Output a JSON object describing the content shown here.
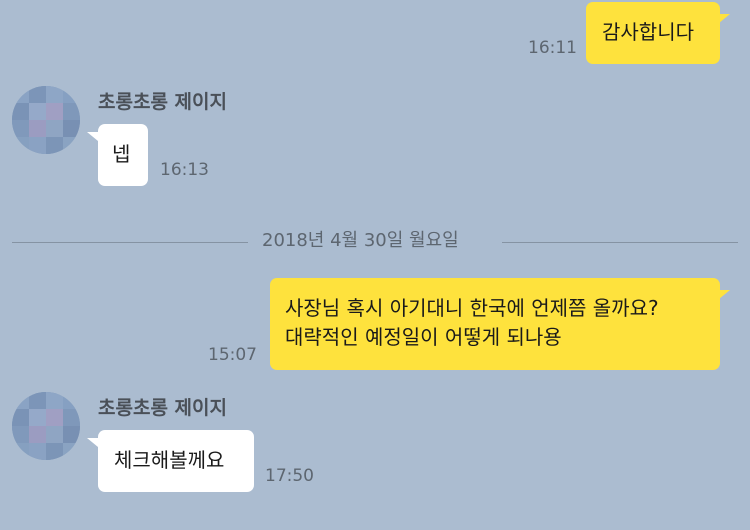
{
  "messages": [
    {
      "side": "sent",
      "text": "감사합니다",
      "time": "16:11"
    },
    {
      "side": "received",
      "sender": "초롱초롱 제이지",
      "text": "넵",
      "time": "16:13"
    },
    {
      "side": "sent",
      "text_lines": [
        "사장님 혹시 아기대니 한국에 언제쯤 올까요?",
        "대략적인 예정일이 어떻게 되나용"
      ],
      "time": "15:07"
    },
    {
      "side": "received",
      "sender": "초롱초롱 제이지",
      "text": "체크해볼께요",
      "time": "17:50"
    }
  ],
  "date_divider": "2018년 4월 30일 월요일",
  "colors": {
    "background": "#abbcd0",
    "sent_bubble": "#fee23d",
    "received_bubble": "#ffffff"
  }
}
